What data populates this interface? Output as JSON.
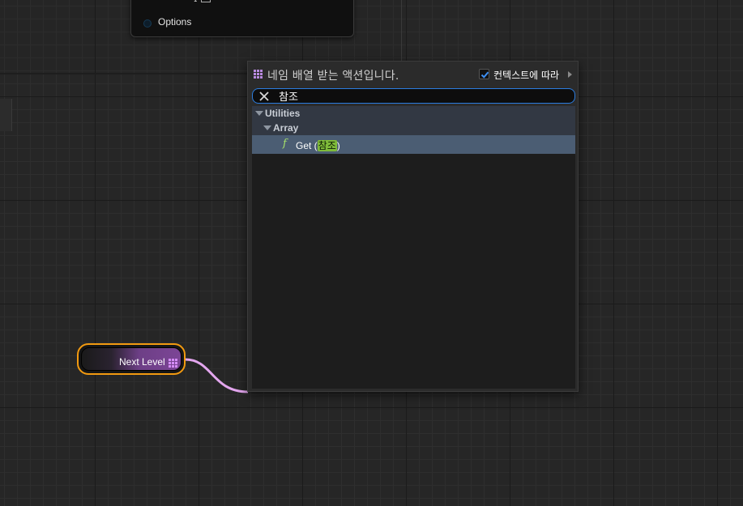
{
  "top_node": {
    "pin_label": "Options",
    "partial_glyph": "ɾ"
  },
  "variable_node": {
    "label": "Next Level",
    "pin_color": "#d58cf7",
    "border_color": "#f29a10"
  },
  "wire_color": "#e3a6ee",
  "action_menu": {
    "title": "네임 배열 받는 액션입니다.",
    "title_icon": "array-grid-icon",
    "context_label": "컨텍스트에 따라",
    "context_checked": true,
    "search": {
      "value": "참조",
      "clear_icon": "close-icon"
    },
    "tree": {
      "category": "Utilities",
      "subcategory": "Array",
      "item": {
        "icon": "f",
        "prefix": "Get (",
        "highlight": "참조",
        "suffix": ")"
      }
    }
  },
  "colors": {
    "canvas": "#262626",
    "accent_blue": "#2b7de0",
    "highlight_green": "#7fbb3a",
    "selected_row": "#4b5d73"
  }
}
